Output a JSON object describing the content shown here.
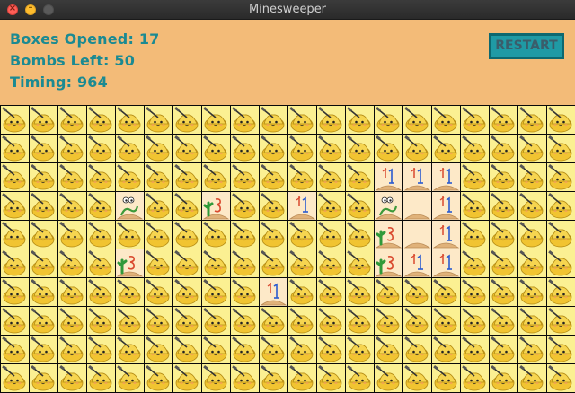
{
  "window": {
    "title": "Minesweeper",
    "close_glyph": "×",
    "minimize_glyph": "–"
  },
  "stats": {
    "boxes_opened": "Boxes Opened: 17",
    "bombs_left": "Bombs Left: 50",
    "timing": "Timing: 964"
  },
  "restart_label": "RESTART",
  "colors": {
    "header_bg": "#f3bb78",
    "stat_text": "#1b8a92",
    "hidden_tile": "#fbf092",
    "open_tile": "#fde9c8",
    "restart_bg": "#1f9aa5"
  },
  "board": {
    "rows": 10,
    "cols": 20,
    "cells": [
      [
        {
          "r": 2,
          "c": 13,
          "icon": "arrow-1-icon"
        },
        {
          "r": 2,
          "c": 14,
          "icon": "arrow-1-icon"
        },
        {
          "r": 2,
          "c": 15,
          "icon": "arrow-1-icon"
        }
      ],
      [
        {
          "r": 3,
          "c": 4,
          "icon": "worm-2-icon"
        },
        {
          "r": 3,
          "c": 7,
          "icon": "cactus-3-icon"
        },
        {
          "r": 3,
          "c": 10,
          "icon": "arrow-1-icon"
        },
        {
          "r": 3,
          "c": 13,
          "icon": "worm-2-icon"
        },
        {
          "r": 3,
          "c": 14,
          "icon": "blank"
        },
        {
          "r": 3,
          "c": 15,
          "icon": "arrow-1-icon"
        }
      ],
      [
        {
          "r": 4,
          "c": 13,
          "icon": "cactus-3-icon"
        },
        {
          "r": 4,
          "c": 14,
          "icon": "blank"
        },
        {
          "r": 4,
          "c": 15,
          "icon": "arrow-1-icon"
        }
      ],
      [
        {
          "r": 5,
          "c": 4,
          "icon": "cactus-3-icon"
        },
        {
          "r": 5,
          "c": 13,
          "icon": "cactus-3-icon"
        },
        {
          "r": 5,
          "c": 14,
          "icon": "arrow-1-icon"
        },
        {
          "r": 5,
          "c": 15,
          "icon": "arrow-1-icon"
        }
      ],
      [
        {
          "r": 6,
          "c": 9,
          "icon": "arrow-1-icon"
        }
      ]
    ]
  }
}
